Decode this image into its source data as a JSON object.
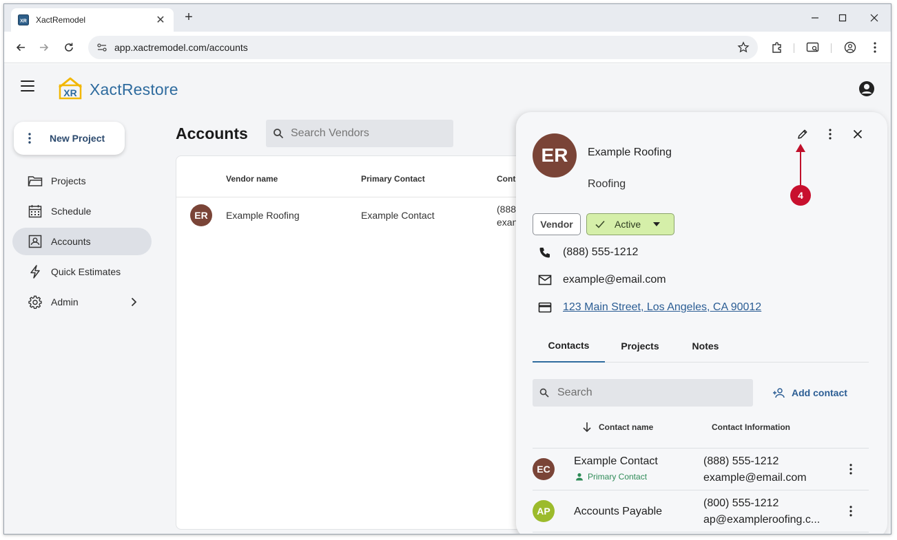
{
  "browser": {
    "tab_title": "XactRemodel",
    "url": "app.xactremodel.com/accounts"
  },
  "app": {
    "brand": "XactRestore",
    "logo_text": "XR",
    "new_project_label": "New Project",
    "nav": [
      {
        "label": "Projects",
        "icon": "folder-icon"
      },
      {
        "label": "Schedule",
        "icon": "calendar-icon"
      },
      {
        "label": "Accounts",
        "icon": "contact-card-icon",
        "active": true
      },
      {
        "label": "Quick Estimates",
        "icon": "lightning-icon"
      },
      {
        "label": "Admin",
        "icon": "gear-icon"
      }
    ]
  },
  "accounts": {
    "title": "Accounts",
    "search_placeholder": "Search Vendors",
    "columns": [
      "Vendor name",
      "Primary Contact",
      "Cont"
    ],
    "rows": [
      {
        "initials": "ER",
        "vendor": "Example Roofing",
        "primary_contact": "Example Contact",
        "contact_line1": "(888",
        "contact_line2": "exan"
      }
    ]
  },
  "panel": {
    "initials": "ER",
    "name": "Example Roofing",
    "category": "Roofing",
    "callout_number": "4",
    "type_chip": "Vendor",
    "status_chip": "Active",
    "phone": "(888) 555-1212",
    "email": "example@email.com",
    "address": "123 Main Street, Los Angeles, CA 90012",
    "tabs": [
      "Contacts",
      "Projects",
      "Notes"
    ],
    "contact_search_placeholder": "Search",
    "add_contact_label": "Add contact",
    "contact_columns": [
      "Contact name",
      "Contact Information"
    ],
    "contacts": [
      {
        "initials": "EC",
        "name": "Example Contact",
        "badge": "Primary Contact",
        "phone": "(888) 555-1212",
        "email": "example@email.com"
      },
      {
        "initials": "AP",
        "name": "Accounts Payable",
        "badge": "",
        "phone": "(800) 555-1212",
        "email": "ap@exampleroofing.c..."
      }
    ]
  },
  "colors": {
    "brand_blue": "#2e6b9e",
    "avatar_brown": "#7a4437",
    "avatar_green": "#9cbb2c",
    "active_chip": "#d5efa9",
    "callout_red": "#c8102e"
  }
}
